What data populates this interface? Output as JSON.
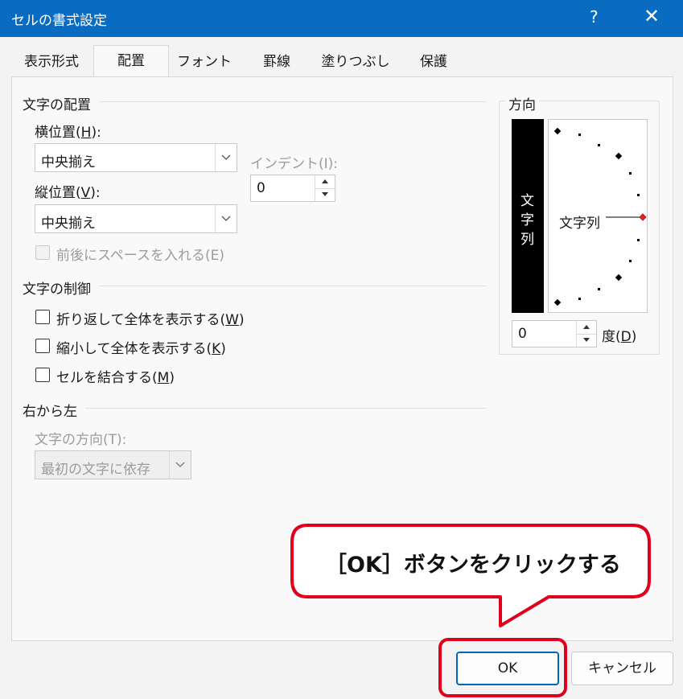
{
  "titlebar": {
    "title": "セルの書式設定",
    "help": "?",
    "close": "✕"
  },
  "tabs": [
    {
      "label": "表示形式"
    },
    {
      "label": "配置"
    },
    {
      "label": "フォント"
    },
    {
      "label": "罫線"
    },
    {
      "label": "塗りつぶし"
    },
    {
      "label": "保護"
    }
  ],
  "alignment": {
    "section": "文字の配置",
    "horizontal": {
      "label_prefix": "横位置(",
      "label_key": "H",
      "label_suffix": "):",
      "value": "中央揃え"
    },
    "indent": {
      "label": "インデント(I):",
      "value": "0"
    },
    "vertical": {
      "label_prefix": "縦位置(",
      "label_key": "V",
      "label_suffix": "):",
      "value": "中央揃え"
    },
    "distributed": {
      "label": "前後にスペースを入れる(E)"
    }
  },
  "text_control": {
    "section": "文字の制御",
    "wrap": {
      "prefix": "折り返して全体を表示する(",
      "key": "W",
      "suffix": ")"
    },
    "shrink": {
      "prefix": "縮小して全体を表示する(",
      "key": "K",
      "suffix": ")"
    },
    "merge": {
      "prefix": "セルを結合する(",
      "key": "M",
      "suffix": ")"
    }
  },
  "rtl": {
    "section": "右から左",
    "direction_label": "文字の方向(T):",
    "direction_value": "最初の文字に依存"
  },
  "orientation": {
    "section": "方向",
    "vertical_text": [
      "文",
      "字",
      "列"
    ],
    "dial_label": "文字列",
    "degrees_value": "0",
    "degrees_prefix": "度(",
    "degrees_key": "D",
    "degrees_suffix": ")"
  },
  "callout": {
    "text": "［OK］ボタンをクリックする",
    "color": "#e0001b"
  },
  "buttons": {
    "ok": "OK",
    "cancel": "キャンセル"
  },
  "colors": {
    "titlebar": "#0a6cc1",
    "accent": "#0067c0",
    "highlight": "#e0001b"
  }
}
